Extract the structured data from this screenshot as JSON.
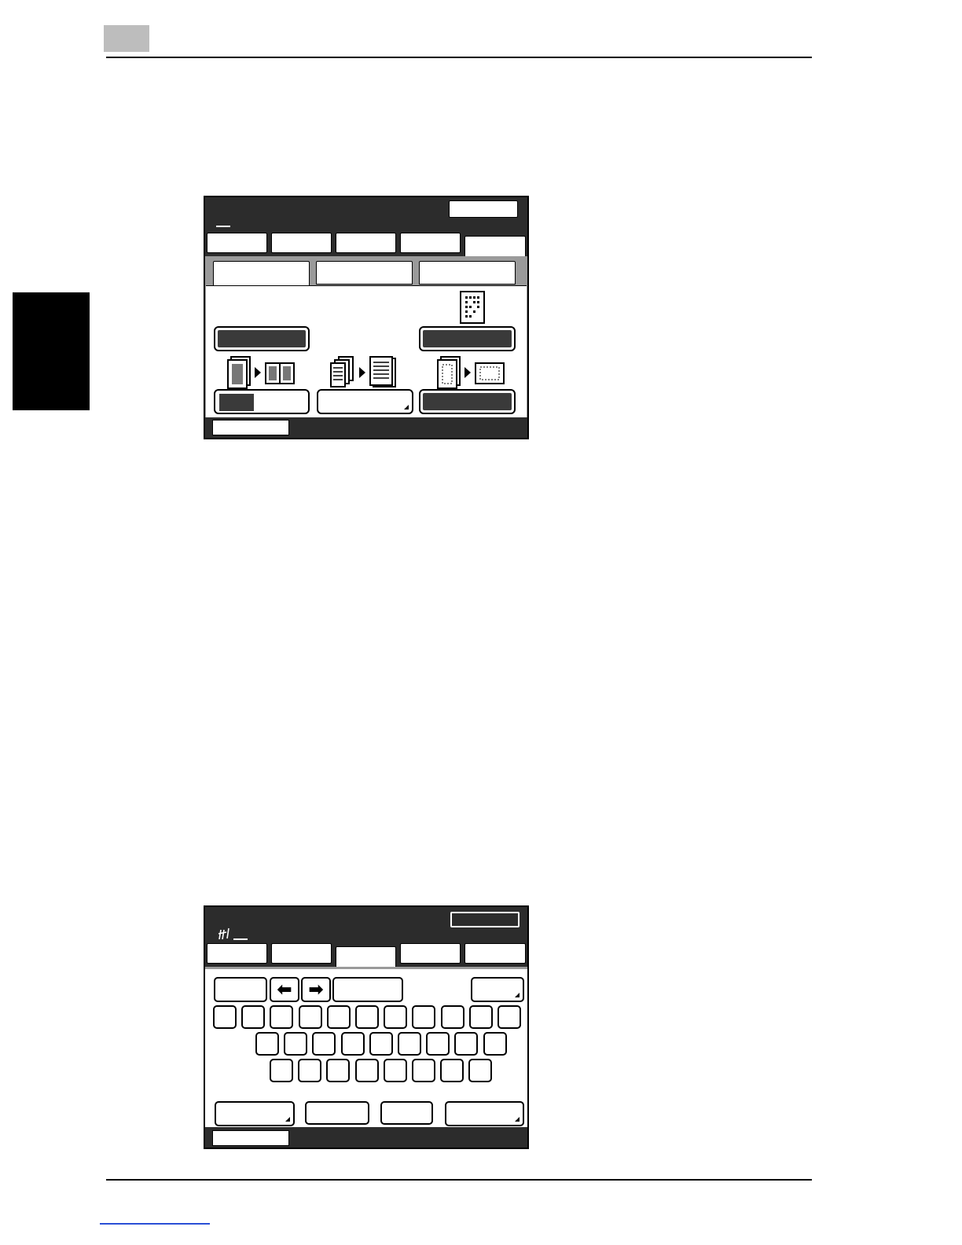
{
  "page": {
    "chapter_number": "",
    "footer_link_text": ""
  },
  "screen1": {
    "name": "basic-settings-screen",
    "tabs": [
      "",
      "",
      "",
      "",
      ""
    ],
    "subtabs": [
      "",
      "",
      ""
    ],
    "icons": [
      "book-copy-icon",
      "sort-group-icon",
      "frame-erase-icon",
      "dot-page-icon"
    ]
  },
  "screen2": {
    "name": "character-input-screen",
    "nav_keys": {
      "left": "⬅",
      "right": "➡"
    },
    "keyboard_rows": [
      11,
      9,
      8
    ]
  }
}
